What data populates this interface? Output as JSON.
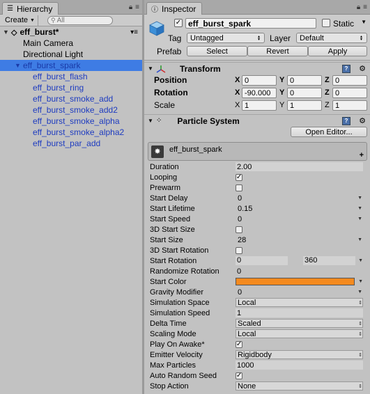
{
  "hierarchy": {
    "tab_label": "Hierarchy",
    "create_label": "Create",
    "search_placeholder": "All",
    "scene_name": "eff_burst*",
    "root_items": [
      {
        "label": "Main Camera"
      },
      {
        "label": "Directional Light"
      }
    ],
    "selected_item": "eff_burst_spark",
    "children": [
      {
        "label": "eff_burst_flash"
      },
      {
        "label": "eff_burst_ring"
      },
      {
        "label": "eff_burst_smoke_add"
      },
      {
        "label": "eff_burst_smoke_add2"
      },
      {
        "label": "eff_burst_smoke_alpha"
      },
      {
        "label": "eff_burst_smoke_alpha2"
      },
      {
        "label": "eff_burst_par_add"
      }
    ]
  },
  "inspector": {
    "tab_label": "Inspector",
    "object_name": "eff_burst_spark",
    "active_checked": true,
    "static_label": "Static",
    "tag_label": "Tag",
    "tag_value": "Untagged",
    "layer_label": "Layer",
    "layer_value": "Default",
    "prefab_label": "Prefab",
    "select_label": "Select",
    "revert_label": "Revert",
    "apply_label": "Apply"
  },
  "transform": {
    "title": "Transform",
    "position_label": "Position",
    "rotation_label": "Rotation",
    "scale_label": "Scale",
    "x": "X",
    "y": "Y",
    "z": "Z",
    "position": {
      "x": "0",
      "y": "0",
      "z": "0"
    },
    "rotation": {
      "x": "-90.000",
      "y": "0",
      "z": "0"
    },
    "scale": {
      "x": "1",
      "y": "1",
      "z": "1"
    }
  },
  "particle": {
    "title": "Particle System",
    "open_editor_label": "Open Editor...",
    "module_name": "eff_burst_spark",
    "start_color": "#f58a1e",
    "rows": {
      "duration": {
        "label": "Duration",
        "value": "2.00"
      },
      "looping": {
        "label": "Looping"
      },
      "prewarm": {
        "label": "Prewarm"
      },
      "start_delay": {
        "label": "Start Delay",
        "value": "0"
      },
      "start_lifetime": {
        "label": "Start Lifetime",
        "value": "0.15"
      },
      "start_speed": {
        "label": "Start Speed",
        "value": "0"
      },
      "start_size_3d": {
        "label": "3D Start Size"
      },
      "start_size": {
        "label": "Start Size",
        "value": "28"
      },
      "start_rotation_3d": {
        "label": "3D Start Rotation"
      },
      "start_rotation": {
        "label": "Start Rotation",
        "min": "0",
        "max": "360"
      },
      "randomize_rotation": {
        "label": "Randomize Rotation",
        "value": "0"
      },
      "start_color": {
        "label": "Start Color"
      },
      "gravity": {
        "label": "Gravity Modifier",
        "value": "0"
      },
      "sim_space": {
        "label": "Simulation Space",
        "value": "Local"
      },
      "sim_speed": {
        "label": "Simulation Speed",
        "value": "1"
      },
      "delta_time": {
        "label": "Delta Time",
        "value": "Scaled"
      },
      "scaling_mode": {
        "label": "Scaling Mode",
        "value": "Local"
      },
      "play_on_awake": {
        "label": "Play On Awake*"
      },
      "emitter_velocity": {
        "label": "Emitter Velocity",
        "value": "Rigidbody"
      },
      "max_particles": {
        "label": "Max Particles",
        "value": "1000"
      },
      "auto_random_seed": {
        "label": "Auto Random Seed"
      },
      "stop_action": {
        "label": "Stop Action",
        "value": "None"
      }
    }
  }
}
